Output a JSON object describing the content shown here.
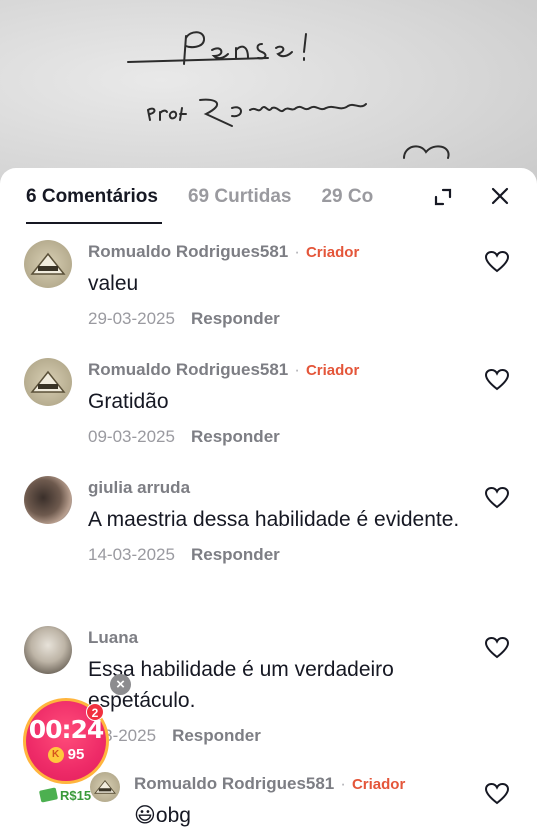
{
  "image": {
    "handwriting_line1": "PENSE!",
    "handwriting_line2": "PROF. ROMUALDO"
  },
  "tabs": [
    {
      "label": "6 Comentários",
      "active": true
    },
    {
      "label": "69 Curtidas",
      "active": false
    },
    {
      "label": "29 Co",
      "active": false
    }
  ],
  "icons": {
    "expand": "expand-icon",
    "close": "close-icon",
    "like": "heart-icon"
  },
  "reply_label": "Responder",
  "creator_badge": "Criador",
  "comments": [
    {
      "author": "Romualdo Rodrigues581",
      "badge": "Criador",
      "text": "valeu",
      "date": "29-03-2025"
    },
    {
      "author": "Romualdo Rodrigues581",
      "badge": "Criador",
      "text": "Gratidão",
      "date": "09-03-2025"
    },
    {
      "author": "giulia arruda",
      "badge": "",
      "text": "A maestria dessa habilidade é evidente.",
      "date": "14-03-2025"
    },
    {
      "author": "Luana",
      "badge": "",
      "text": "Essa habilidade é um verdadeiro espetáculo.",
      "date": "-03-2025"
    },
    {
      "author": "Romualdo Rodrigues581",
      "badge": "Criador",
      "text": "obg",
      "emoji": "😃",
      "date": ""
    }
  ],
  "widget": {
    "timer": "00:24",
    "coin_symbol": "K",
    "coins": "95",
    "notification_count": "2",
    "close_symbol": "×",
    "cash": "R$15"
  },
  "colors": {
    "badge": "#e4563a",
    "timer_bg": "#ee2b68",
    "timer_border": "#ffb53d"
  }
}
